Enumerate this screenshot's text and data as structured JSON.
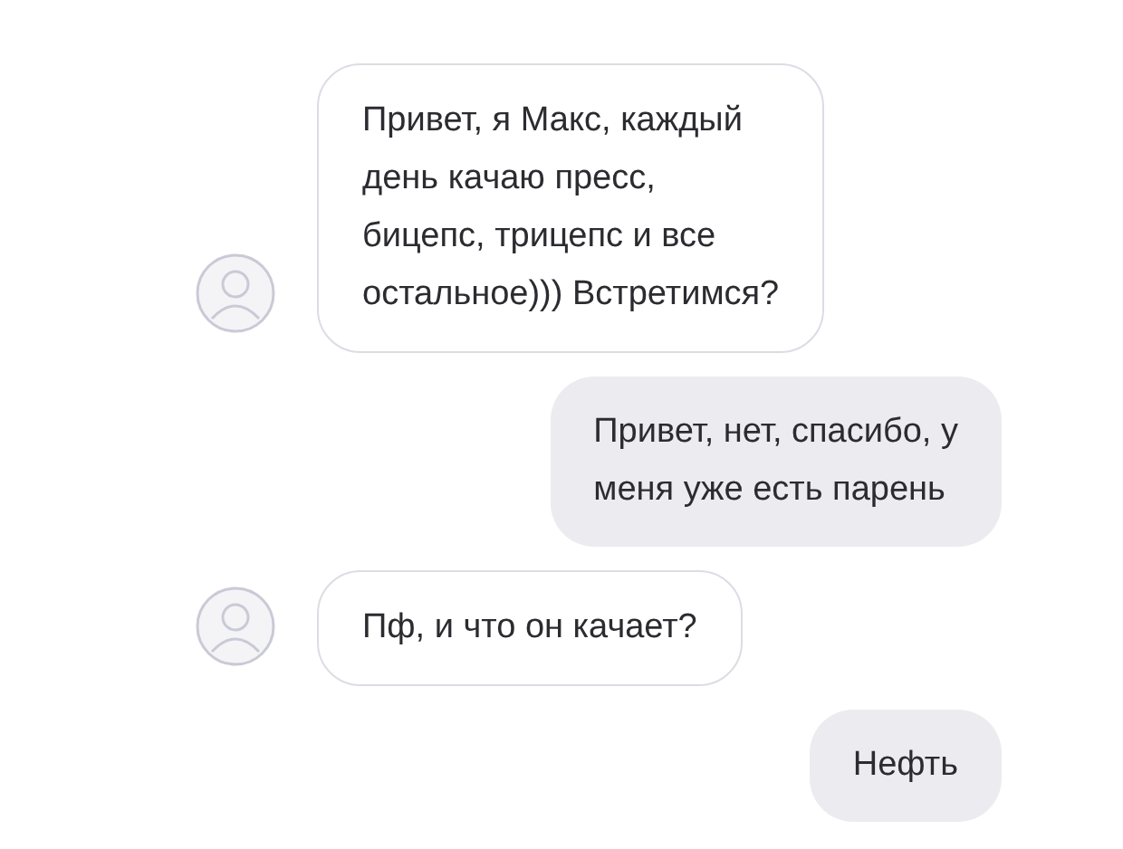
{
  "messages": [
    {
      "kind": "incoming",
      "text": "Привет, я Макс, каждый\nдень качаю пресс,\nбицепс, трицепс и все\nостальное))) Встретимся?"
    },
    {
      "kind": "outgoing",
      "text": "Привет, нет, спасибо, у\nменя уже есть парень"
    },
    {
      "kind": "incoming",
      "text": "Пф, и что он качает?"
    },
    {
      "kind": "outgoing",
      "text": "Нефть"
    }
  ]
}
